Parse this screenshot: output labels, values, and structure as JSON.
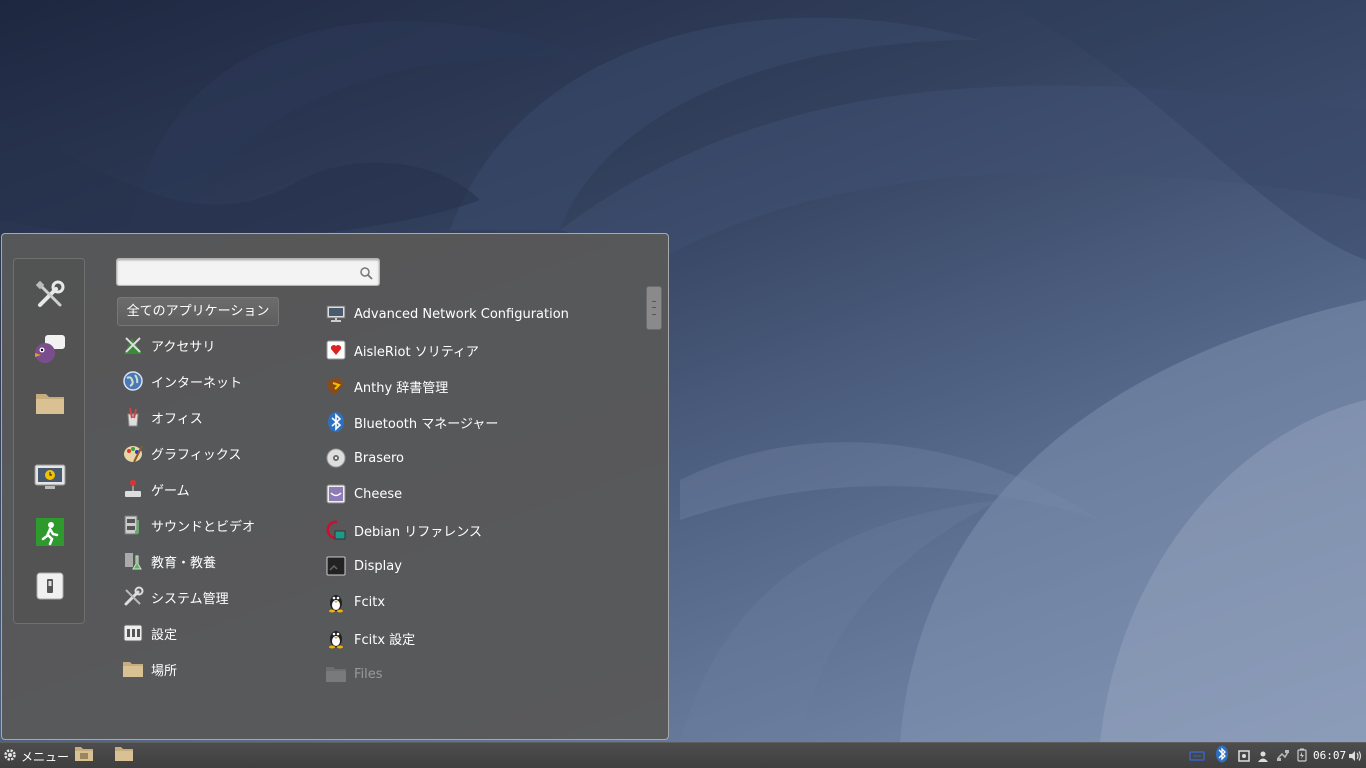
{
  "search": {
    "placeholder": "",
    "value": ""
  },
  "favorites": [
    {
      "icon": "tools-icon"
    },
    {
      "icon": "pidgin-icon"
    },
    {
      "icon": "folder-icon"
    },
    {
      "icon": "lock-screen-icon"
    },
    {
      "icon": "logout-icon"
    },
    {
      "icon": "shutdown-icon"
    }
  ],
  "categories": {
    "all": "全てのアプリケーション",
    "items": [
      {
        "label": "アクセサリ",
        "icon": "accessories-icon"
      },
      {
        "label": "インターネット",
        "icon": "internet-icon"
      },
      {
        "label": "オフィス",
        "icon": "office-icon"
      },
      {
        "label": "グラフィックス",
        "icon": "graphics-icon"
      },
      {
        "label": "ゲーム",
        "icon": "games-icon"
      },
      {
        "label": "サウンドとビデオ",
        "icon": "multimedia-icon"
      },
      {
        "label": "教育・教養",
        "icon": "education-icon"
      },
      {
        "label": "システム管理",
        "icon": "system-tools-icon"
      },
      {
        "label": "設定",
        "icon": "settings-icon"
      },
      {
        "label": "場所",
        "icon": "places-folder-icon"
      }
    ]
  },
  "apps": [
    {
      "label": "Advanced Network Configuration",
      "icon": "network-config-icon"
    },
    {
      "label": "AisleRiot ソリティア",
      "icon": "cards-icon"
    },
    {
      "label": "Anthy 辞書管理",
      "icon": "dictionary-icon"
    },
    {
      "label": "Bluetooth マネージャー",
      "icon": "bluetooth-icon"
    },
    {
      "label": "Brasero",
      "icon": "disc-icon"
    },
    {
      "label": "Cheese",
      "icon": "cheese-icon"
    },
    {
      "label": "Debian リファレンス",
      "icon": "debian-icon"
    },
    {
      "label": "Display",
      "icon": "display-icon"
    },
    {
      "label": "Fcitx",
      "icon": "tux-icon"
    },
    {
      "label": "Fcitx 設定",
      "icon": "tux-icon"
    },
    {
      "label": "Files",
      "icon": "folder-icon"
    }
  ],
  "taskbar": {
    "menu_label": "メニュー",
    "clock": "06:07"
  },
  "colors": {
    "menu_bg": "#585858",
    "taskbar_bg": "#464646",
    "text": "#ffffff",
    "dim_text": "#9a9a9a"
  }
}
